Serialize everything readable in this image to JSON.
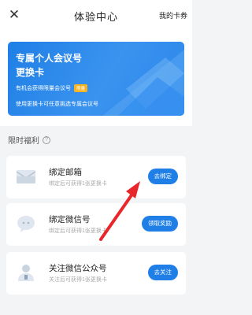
{
  "header": {
    "close_glyph": "✕",
    "title": "体验中心",
    "my_cards": "我的卡券"
  },
  "banner": {
    "title_line1": "专属个人会议号",
    "title_line2": "更换卡",
    "subtitle": "有机会获得限量会议号",
    "badge": "限量",
    "note": "使用更换卡可任意挑选专属会议号",
    "colors": {
      "background": "#1f7fe6",
      "badge": "#f7b21f"
    }
  },
  "benefits": {
    "title": "限时福利",
    "help_glyph": "?",
    "items": [
      {
        "icon": "mail-icon",
        "title": "绑定邮箱",
        "desc": "绑定后可获得1张更换卡",
        "button": "去绑定"
      },
      {
        "icon": "wechat-icon",
        "title": "绑定微信号",
        "desc": "绑定后可获得1张更换卡",
        "button": "领取奖励"
      },
      {
        "icon": "official-account-icon",
        "title": "关注微信公众号",
        "desc": "关注后可获得1张更换卡",
        "button": "去关注"
      }
    ]
  },
  "annotation": {
    "arrow_color": "#e8262b"
  }
}
